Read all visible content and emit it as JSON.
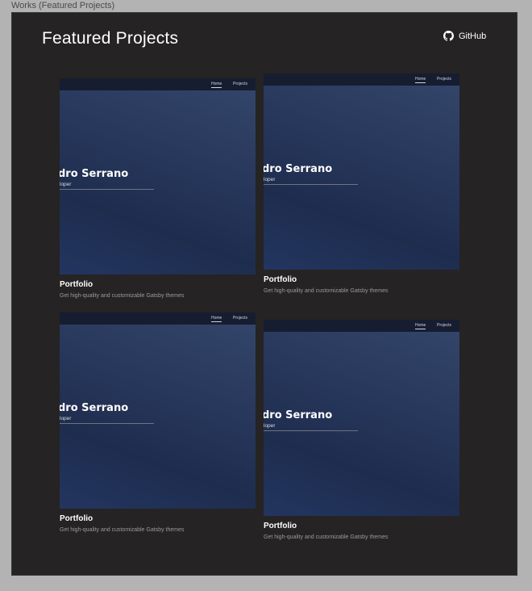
{
  "frame": {
    "label": "Works (Featured Projects)"
  },
  "header": {
    "title": "Featured Projects",
    "github_label": "GitHub"
  },
  "colors": {
    "canvas_bg": "#b3b3b3",
    "frame_bg": "#252323",
    "thumb_top": "#34466b",
    "thumb_bottom": "#1e2d4e"
  },
  "cards": [
    {
      "nav_home": "Home",
      "nav_projects": "Projects",
      "hero_name": "dro Serrano",
      "hero_role": "loper",
      "title": "Portfolio",
      "description": "Get high-quality and customizable Gatsby themes"
    },
    {
      "nav_home": "Home",
      "nav_projects": "Projects",
      "hero_name": "dro Serrano",
      "hero_role": "loper",
      "title": "Portfolio",
      "description": "Get high-quality and customizable Gatsby themes"
    },
    {
      "nav_home": "Home",
      "nav_projects": "Projects",
      "hero_name": "dro Serrano",
      "hero_role": "loper",
      "title": "Portfolio",
      "description": "Get high-quality and customizable Gatsby themes"
    },
    {
      "nav_home": "Home",
      "nav_projects": "Projects",
      "hero_name": "dro Serrano",
      "hero_role": "loper",
      "title": "Portfolio",
      "description": "Get high-quality and customizable Gatsby themes"
    }
  ]
}
